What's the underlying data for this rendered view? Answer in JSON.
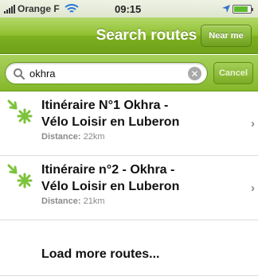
{
  "status_bar": {
    "carrier": "Orange F",
    "time": "09:15",
    "battery_level": 0.85
  },
  "nav_bar": {
    "title": "Search routes",
    "near_me_label": "Near me"
  },
  "search": {
    "query": "okhra",
    "cancel_label": "Cancel"
  },
  "routes": [
    {
      "title_line1": "Itinéraire N°1 Okhra -",
      "title_line2": "Vélo Loisir en Luberon",
      "distance_label": "Distance:",
      "distance_value": "22km"
    },
    {
      "title_line1": "Itinéraire n°2 - Okhra -",
      "title_line2": "Vélo Loisir en Luberon",
      "distance_label": "Distance:",
      "distance_value": "21km"
    }
  ],
  "load_more_label": "Load more routes...",
  "colors": {
    "accent_green": "#8fc02f",
    "icon_green": "#7cc23a"
  }
}
